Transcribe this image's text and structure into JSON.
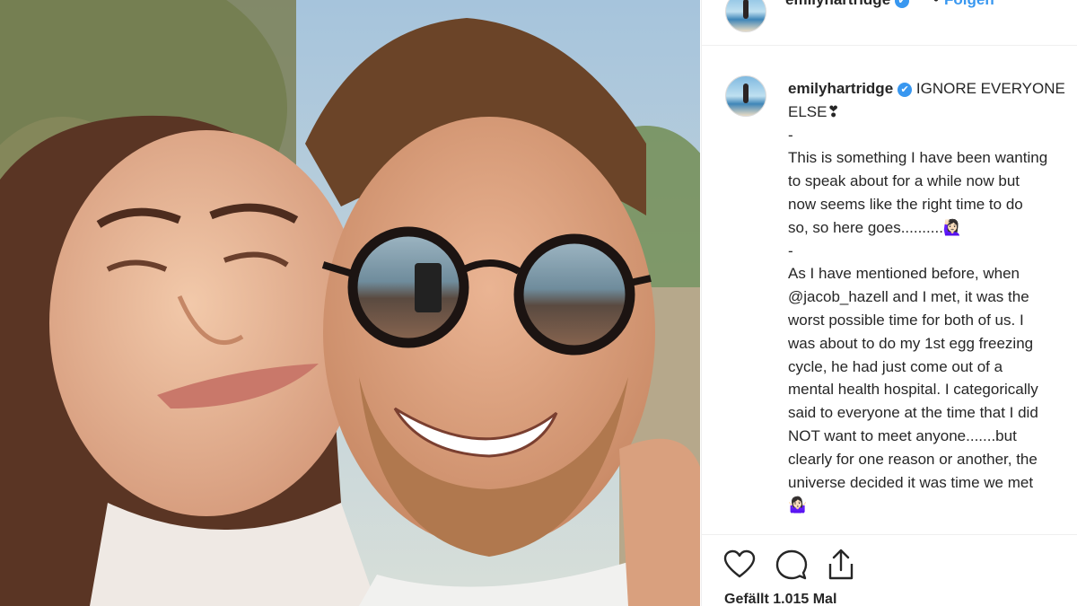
{
  "post": {
    "username": "emilyhartridge",
    "verified_mark": "✔",
    "separator": "•",
    "follow_label": "Folgen",
    "caption_lines": [
      "IGNORE EVERYONE",
      "ELSE❣",
      "-",
      "This is something I have been wanting",
      "to speak about for a while now but",
      "now seems like the right time to do",
      "so, so here goes..........🙋🏻‍♀️",
      "-",
      "As I have mentioned before, when",
      "and I met, it was the",
      "worst possible time for both of us. I",
      "was about to do my 1st egg freezing",
      "cycle, he had just come out of a",
      "mental health hospital. I categorically",
      "said to everyone at the time that I did",
      "NOT want to meet anyone.......but",
      "clearly for one reason or another, the",
      "universe decided it was time we met",
      "🤷🏻‍♀️"
    ],
    "mention": "@jacob_hazell",
    "likes_text": "Gefällt 1.015 Mal"
  },
  "icons": {
    "like": "heart-icon",
    "comment": "comment-icon",
    "share": "share-icon"
  },
  "colors": {
    "link_blue": "#3897f0",
    "text": "#262626",
    "divider": "#efefef"
  }
}
